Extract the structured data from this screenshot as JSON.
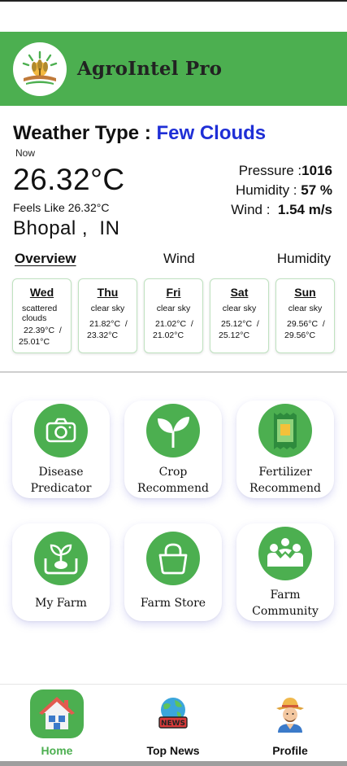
{
  "app": {
    "title": "AgroIntel Pro"
  },
  "weather": {
    "type_label": "Weather Type : ",
    "type_value": "Few Clouds",
    "now_label": "Now",
    "temperature": "26.32°C",
    "feels_like": "Feels Like 26.32°C",
    "city": "Bhopal ,  IN",
    "pressure_label": "Pressure :",
    "pressure_value": "1016",
    "humidity_label": "Humidity : ",
    "humidity_value": "57 %",
    "wind_label": "Wind : ",
    "wind_value": " 1.54 m/s"
  },
  "tabs": {
    "overview": "Overview",
    "wind": "Wind",
    "humidity": "Humidity"
  },
  "forecast": [
    {
      "day": "Wed",
      "desc": "scattered clouds",
      "range_a": "22.39°C  /",
      "range_b": "25.01°C"
    },
    {
      "day": "Thu",
      "desc": "clear sky",
      "range_a": "21.82°C  /",
      "range_b": "23.32°C"
    },
    {
      "day": "Fri",
      "desc": "clear sky",
      "range_a": "21.02°C  /",
      "range_b": "21.02°C"
    },
    {
      "day": "Sat",
      "desc": "clear sky",
      "range_a": "25.12°C  /",
      "range_b": "25.12°C"
    },
    {
      "day": "Sun",
      "desc": "clear sky",
      "range_a": "29.56°C  /",
      "range_b": "29.56°C"
    }
  ],
  "features": [
    {
      "line1": "Disease",
      "line2": "Predicator",
      "icon": "camera-icon"
    },
    {
      "line1": "Crop",
      "line2": "Recommend",
      "icon": "sprout-icon"
    },
    {
      "line1": "Fertilizer",
      "line2": "Recommend",
      "icon": "fertilizer-bag-icon"
    },
    {
      "line1": "My Farm",
      "line2": "",
      "icon": "farm-plant-icon"
    },
    {
      "line1": "Farm Store",
      "line2": "",
      "icon": "shopping-bag-icon"
    },
    {
      "line1": "Farm",
      "line2": "Community",
      "icon": "community-icon"
    }
  ],
  "nav": {
    "home": "Home",
    "news": "Top News",
    "profile": "Profile"
  },
  "colors": {
    "accent": "#4caf50",
    "weather_value": "#1f2fd6"
  }
}
